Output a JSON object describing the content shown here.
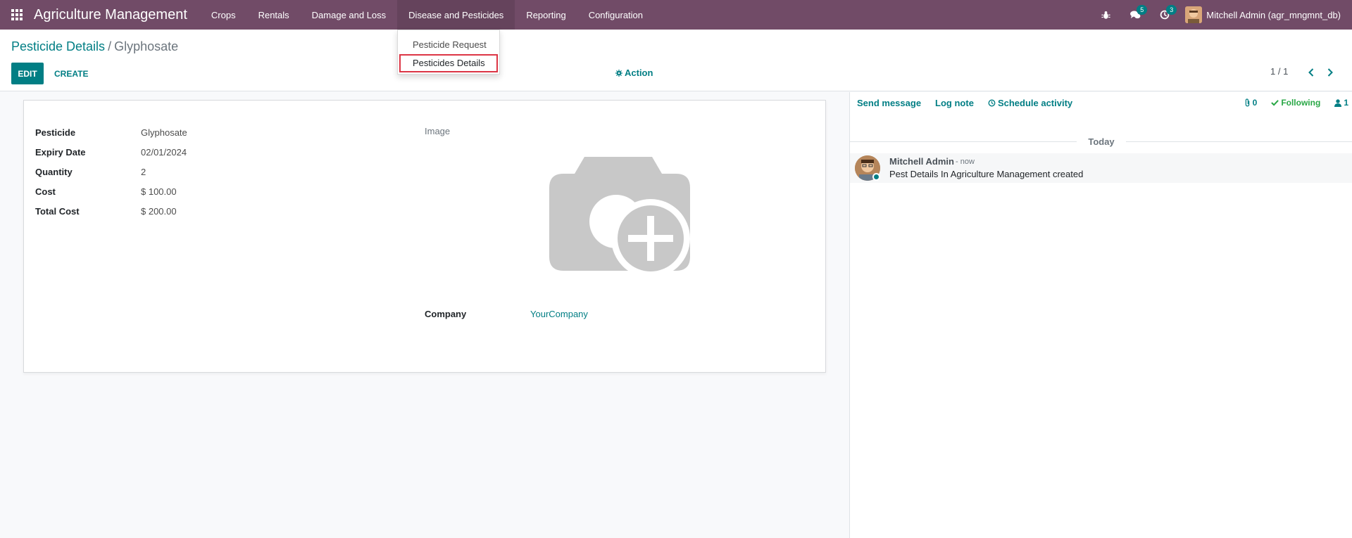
{
  "navbar": {
    "brand": "Agriculture Management",
    "menu": [
      {
        "label": "Crops"
      },
      {
        "label": "Rentals"
      },
      {
        "label": "Damage and Loss"
      },
      {
        "label": "Disease and Pesticides"
      },
      {
        "label": "Reporting"
      },
      {
        "label": "Configuration"
      }
    ],
    "messages_count": "5",
    "activities_count": "3",
    "user_name": "Mitchell Admin (agr_mngmnt_db)",
    "bg_color": "#714b67"
  },
  "dropdown": {
    "items": [
      {
        "label": "Pesticide Request"
      },
      {
        "label": "Pesticides Details"
      }
    ]
  },
  "control_panel": {
    "breadcrumb_parent": "Pesticide Details",
    "breadcrumb_sep": "/",
    "breadcrumb_current": "Glyphosate",
    "edit_label": "EDIT",
    "create_label": "CREATE",
    "action_label": "Action",
    "pager": "1 / 1"
  },
  "form": {
    "fields": [
      {
        "label": "Pesticide",
        "value": "Glyphosate"
      },
      {
        "label": "Expiry Date",
        "value": "02/01/2024"
      },
      {
        "label": "Quantity",
        "value": "2"
      },
      {
        "label": "Cost",
        "value": "$ 100.00"
      },
      {
        "label": "Total Cost",
        "value": "$ 200.00"
      }
    ],
    "image_label": "Image",
    "company_label": "Company",
    "company_value": "YourCompany"
  },
  "chatter": {
    "send_message": "Send message",
    "log_note": "Log note",
    "schedule_activity": "Schedule activity",
    "attachments_count": "0",
    "following": "Following",
    "followers_count": "1",
    "today": "Today",
    "message": {
      "author": "Mitchell Admin",
      "date": "- now",
      "body": "Pest Details In Agriculture Management created"
    }
  },
  "colors": {
    "primary": "#017e84",
    "brand": "#714b67",
    "following": "#28a745"
  }
}
